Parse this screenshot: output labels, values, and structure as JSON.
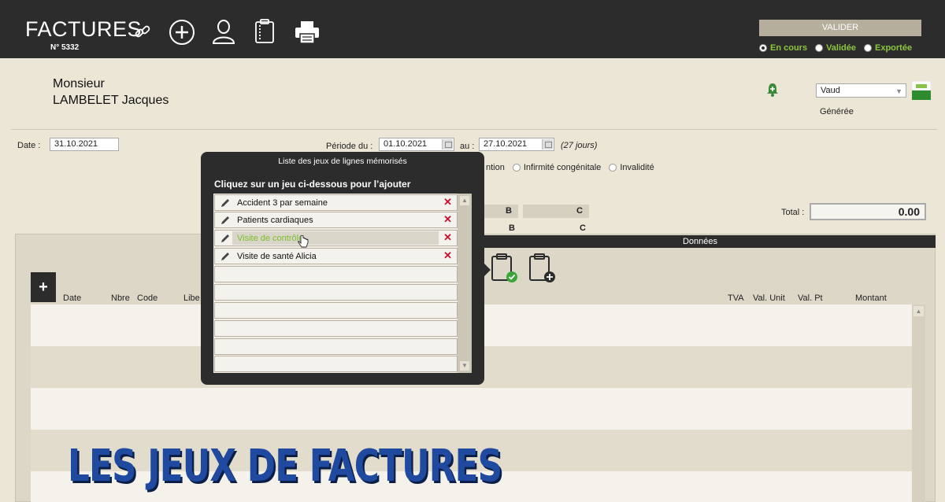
{
  "header": {
    "title": "FACTURES",
    "invoice_number": "N° 5332",
    "icons": [
      "link-icon",
      "add-circle-icon",
      "user-icon",
      "clipboard-icon",
      "print-icon"
    ],
    "validate_label": "VALIDER",
    "status": {
      "options": [
        "En cours",
        "Validée",
        "Exportée"
      ],
      "selected": "En cours"
    }
  },
  "patient": {
    "civility": "Monsieur",
    "name": "LAMBELET Jacques",
    "canton": "Vaud",
    "state": "Générée"
  },
  "dates": {
    "date_label": "Date :",
    "date_value": "31.10.2021",
    "period_from_label": "Période du :",
    "period_from": "01.10.2021",
    "period_to_label": "au :",
    "period_to": "27.10.2021",
    "days": "(27 jours)"
  },
  "law": {
    "partial_label": "ntion",
    "options": [
      "Infirmité congénitale",
      "Invalidité"
    ]
  },
  "cells": [
    "B",
    "C",
    "B",
    "C"
  ],
  "total": {
    "label": "Total :",
    "value": "0.00"
  },
  "data_section": {
    "title": "Données",
    "add_label": "+",
    "columns_left": [
      "Date",
      "Nbre",
      "Code",
      "Libe"
    ],
    "columns_right": [
      "TVA",
      "Val. Unit",
      "Val. Pt",
      "Montant"
    ]
  },
  "popup": {
    "title": "Liste des jeux de lignes mémorisés",
    "subtitle": "Cliquez sur un jeu ci-dessous pour l’ajouter",
    "items": [
      {
        "label": "Accident 3 par semaine"
      },
      {
        "label": "Patients cardiaques"
      },
      {
        "label": "Visite de contrôle"
      },
      {
        "label": "Visite de santé Alicia"
      }
    ],
    "highlighted_index": 2,
    "delete_symbol": "✕"
  },
  "banner": "LES JEUX DE FACTURES",
  "colors": {
    "header_bg": "#2c2c2c",
    "page_bg": "#ebe6d6",
    "status_green": "#8cc63f",
    "delete_red": "#c8102e",
    "banner_blue": "#1f4aa0"
  }
}
